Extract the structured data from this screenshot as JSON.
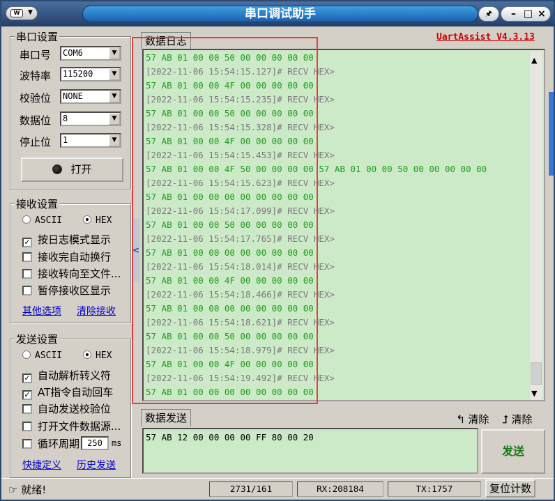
{
  "title": {
    "app_button_logo": "W",
    "app_button_arrow": "▼",
    "text": "串口调试助手",
    "pin_glyph": "🖈",
    "minimize_glyph": "–",
    "maximize_glyph": "□",
    "close_glyph": "×"
  },
  "serial_settings": {
    "legend": "串口设置",
    "port": {
      "label": "串口号",
      "value": "COM6"
    },
    "baud": {
      "label": "波特率",
      "value": "115200"
    },
    "parity": {
      "label": "校验位",
      "value": "NONE"
    },
    "databits": {
      "label": "数据位",
      "value": "8"
    },
    "stopbits": {
      "label": "停止位",
      "value": "1"
    },
    "open_button": "打开"
  },
  "receive_settings": {
    "legend": "接收设置",
    "ascii_label": "ASCII",
    "hex_label": "HEX",
    "mode_selected": "HEX",
    "options": [
      {
        "label": "按日志模式显示",
        "checked": true
      },
      {
        "label": "接收完自动换行",
        "checked": false
      },
      {
        "label": "接收转向至文件...",
        "checked": false
      },
      {
        "label": "暂停接收区显示",
        "checked": false
      }
    ],
    "link_more": "其他选项",
    "link_clear": "清除接收"
  },
  "send_settings": {
    "legend": "发送设置",
    "ascii_label": "ASCII",
    "hex_label": "HEX",
    "mode_selected": "HEX",
    "options": [
      {
        "label": "自动解析转义符",
        "checked": true
      },
      {
        "label": "AT指令自动回车",
        "checked": true
      },
      {
        "label": "自动发送校验位",
        "checked": false
      },
      {
        "label": "打开文件数据源...",
        "checked": false
      }
    ],
    "cycle_label": "循环周期",
    "cycle_value": "250",
    "cycle_unit": "ms",
    "link_shortcut": "快捷定义",
    "link_history": "历史发送"
  },
  "log": {
    "tab_label": "数据日志",
    "version": "UartAssist V4.3.13",
    "lines": [
      {
        "type": "data",
        "text": "57 AB 01 00 00 50 00 00 00 00 00"
      },
      {
        "type": "stamp",
        "text": "[2022-11-06 15:54:15.127]# RECV HEX>"
      },
      {
        "type": "data",
        "text": "57 AB 01 00 00 4F 00 00 00 00 00"
      },
      {
        "type": "stamp",
        "text": "[2022-11-06 15:54:15.235]# RECV HEX>"
      },
      {
        "type": "data",
        "text": "57 AB 01 00 00 50 00 00 00 00 00"
      },
      {
        "type": "stamp",
        "text": "[2022-11-06 15:54:15.328]# RECV HEX>"
      },
      {
        "type": "data",
        "text": "57 AB 01 00 00 4F 00 00 00 00 00"
      },
      {
        "type": "stamp",
        "text": "[2022-11-06 15:54:15.453]# RECV HEX>"
      },
      {
        "type": "data",
        "text": "57 AB 01 00 00 4F 50 00 00 00 00 57 AB 01 00 00 50 00 00 00 00 00"
      },
      {
        "type": "stamp",
        "text": "[2022-11-06 15:54:15.623]# RECV HEX>"
      },
      {
        "type": "data",
        "text": "57 AB 01 00 00 00 00 00 00 00 00"
      },
      {
        "type": "stamp",
        "text": "[2022-11-06 15:54:17.099]# RECV HEX>"
      },
      {
        "type": "data",
        "text": "57 AB 01 00 00 50 00 00 00 00 00"
      },
      {
        "type": "stamp",
        "text": "[2022-11-06 15:54:17.765]# RECV HEX>"
      },
      {
        "type": "data",
        "text": "57 AB 01 00 00 00 00 00 00 00 00"
      },
      {
        "type": "stamp",
        "text": "[2022-11-06 15:54:18.014]# RECV HEX>"
      },
      {
        "type": "data",
        "text": "57 AB 01 00 00 4F 00 00 00 00 00"
      },
      {
        "type": "stamp",
        "text": "[2022-11-06 15:54:18.466]# RECV HEX>"
      },
      {
        "type": "data",
        "text": "57 AB 01 00 00 00 00 00 00 00 00"
      },
      {
        "type": "stamp",
        "text": "[2022-11-06 15:54:18.621]# RECV HEX>"
      },
      {
        "type": "data",
        "text": "57 AB 01 00 00 50 00 00 00 00 00"
      },
      {
        "type": "stamp",
        "text": "[2022-11-06 15:54:18.979]# RECV HEX>"
      },
      {
        "type": "data",
        "text": "57 AB 01 00 00 4F 00 00 00 00 00"
      },
      {
        "type": "stamp",
        "text": "[2022-11-06 15:54:19.492]# RECV HEX>"
      },
      {
        "type": "data",
        "text": "57 AB 01 00 00 00 00 00 00 00 00"
      }
    ],
    "scroll_up": "▲",
    "scroll_down": "▼",
    "collapse_glyph": "<"
  },
  "send": {
    "tab_label": "数据发送",
    "text": "57 AB 12 00 00 00 00 FF 80 00 20",
    "clear1": "清除",
    "clear2": "清除",
    "send_button": "发送"
  },
  "status": {
    "ready": "就绪!",
    "counts": "2731/161",
    "rx": "RX:208184",
    "tx": "TX:1757",
    "reset_button": "复位计数"
  },
  "colors": {
    "accent": "#1b5fae",
    "log_bg": "#cdeac8",
    "data_text": "#1f9c1f",
    "highlight": "#e53b3b"
  }
}
